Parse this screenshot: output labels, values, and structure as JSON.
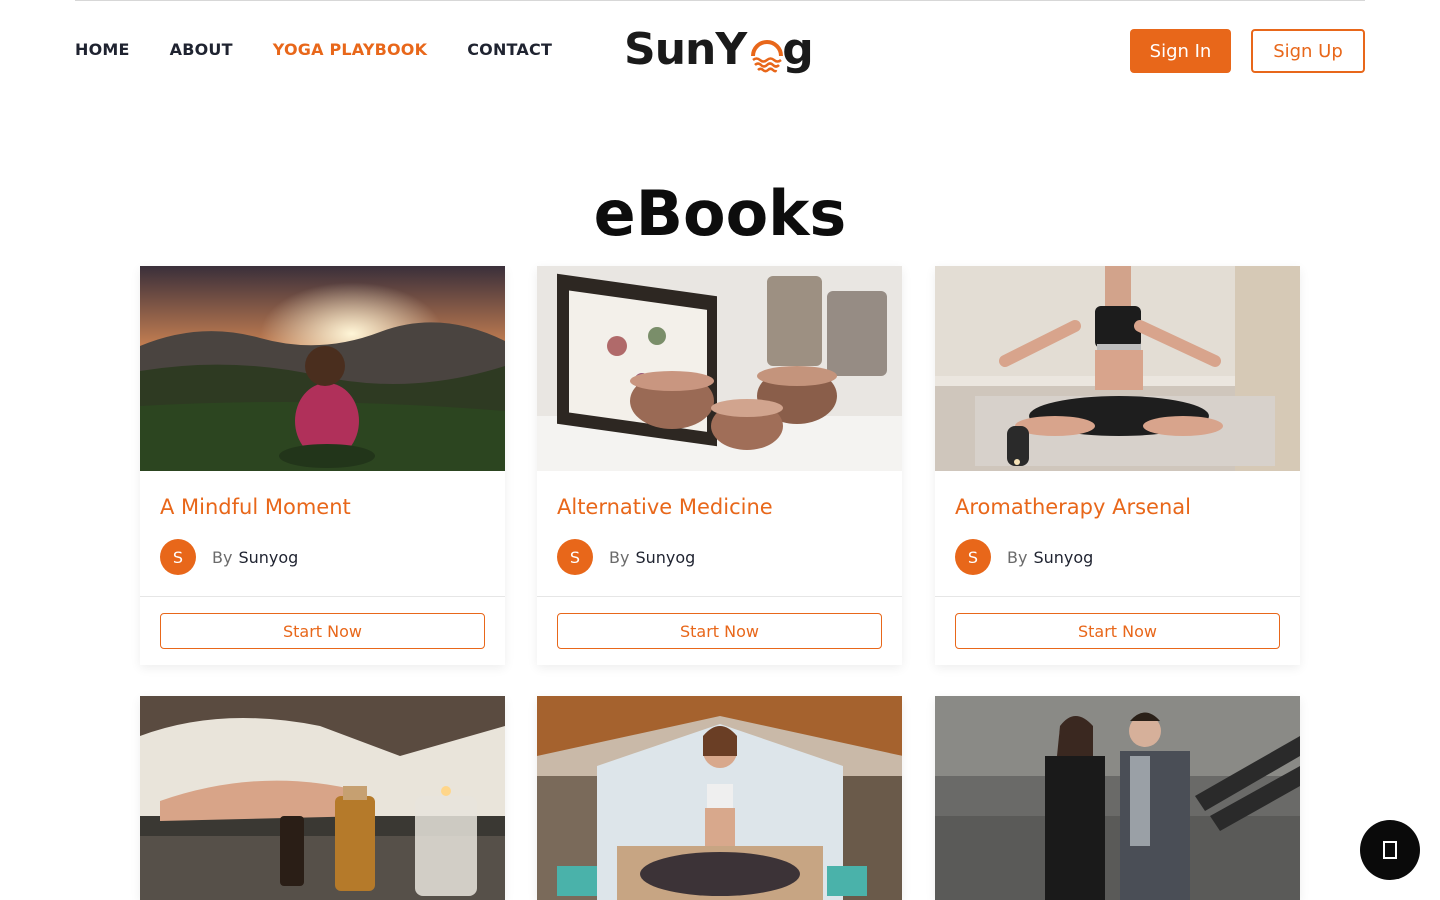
{
  "nav": {
    "items": [
      {
        "label": "HOME",
        "active": false
      },
      {
        "label": "ABOUT",
        "active": false
      },
      {
        "label": "YOGA PLAYBOOK",
        "active": true
      },
      {
        "label": "CONTACT",
        "active": false
      }
    ]
  },
  "logo": {
    "part1": "SunY",
    "part2": "g",
    "icon": "sun-over-waves-icon"
  },
  "auth": {
    "sign_in": "Sign In",
    "sign_up": "Sign Up"
  },
  "page": {
    "title": "eBooks"
  },
  "cards": [
    {
      "title": "A Mindful Moment",
      "avatar": "S",
      "by": "By",
      "author": "Sunyog",
      "cta": "Start Now"
    },
    {
      "title": "Alternative Medicine",
      "avatar": "S",
      "by": "By",
      "author": "Sunyog",
      "cta": "Start Now"
    },
    {
      "title": "Aromatherapy Arsenal",
      "avatar": "S",
      "by": "By",
      "author": "Sunyog",
      "cta": "Start Now"
    },
    {
      "title": "",
      "avatar": "",
      "by": "",
      "author": "",
      "cta": ""
    },
    {
      "title": "",
      "avatar": "",
      "by": "",
      "author": "",
      "cta": ""
    },
    {
      "title": "",
      "avatar": "",
      "by": "",
      "author": "",
      "cta": ""
    }
  ],
  "colors": {
    "accent": "#e8671a",
    "text": "#1f2330",
    "fab": "#0a0a0a"
  },
  "fab": {
    "icon": "chat-icon"
  }
}
